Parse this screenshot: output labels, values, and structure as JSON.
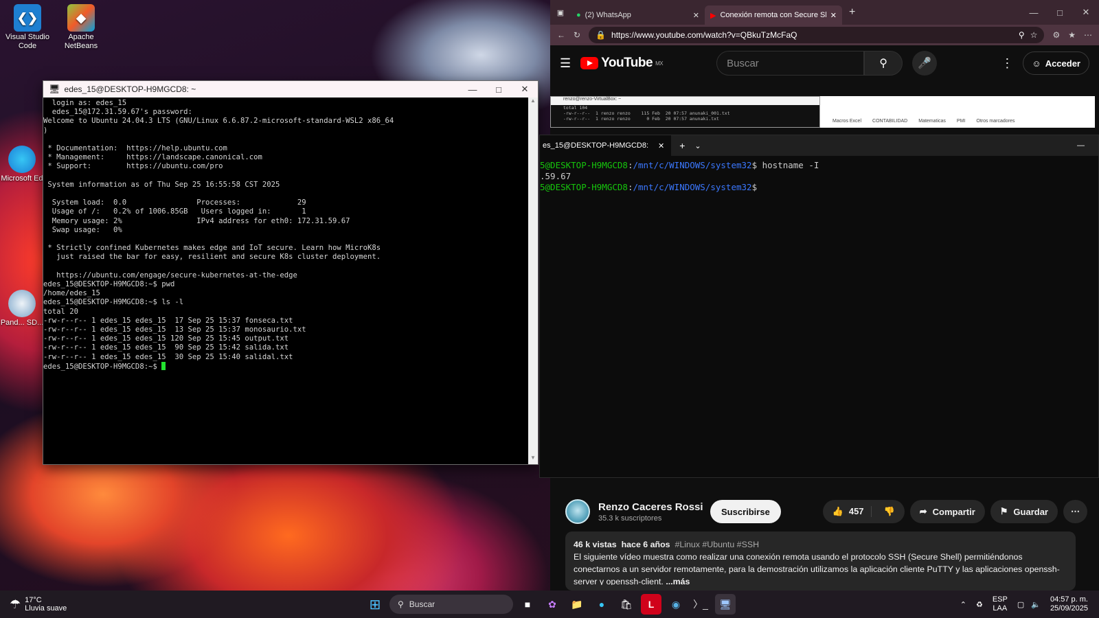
{
  "desktop": {
    "icons": [
      {
        "label": "Visual Studio Code"
      },
      {
        "label": "Apache NetBeans"
      },
      {
        "label": "Microsoft Ed"
      },
      {
        "label": "Pand... SD..."
      }
    ]
  },
  "putty": {
    "title": "edes_15@DESKTOP-H9MGCD8: ~",
    "lines": [
      "  login as: edes_15",
      "  edes_15@172.31.59.67's password:",
      "Welcome to Ubuntu 24.04.3 LTS (GNU/Linux 6.6.87.2-microsoft-standard-WSL2 x86_64",
      ")",
      "",
      " * Documentation:  https://help.ubuntu.com",
      " * Management:     https://landscape.canonical.com",
      " * Support:        https://ubuntu.com/pro",
      "",
      " System information as of Thu Sep 25 16:55:58 CST 2025",
      "",
      "  System load:  0.0                Processes:             29",
      "  Usage of /:   0.2% of 1006.85GB   Users logged in:       1",
      "  Memory usage: 2%                 IPv4 address for eth0: 172.31.59.67",
      "  Swap usage:   0%",
      "",
      " * Strictly confined Kubernetes makes edge and IoT secure. Learn how MicroK8s",
      "   just raised the bar for easy, resilient and secure K8s cluster deployment.",
      "",
      "   https://ubuntu.com/engage/secure-kubernetes-at-the-edge",
      "edes_15@DESKTOP-H9MGCD8:~$ pwd",
      "/home/edes_15",
      "edes_15@DESKTOP-H9MGCD8:~$ ls -l",
      "total 20",
      "-rw-r--r-- 1 edes_15 edes_15  17 Sep 25 15:37 fonseca.txt",
      "-rw-r--r-- 1 edes_15 edes_15  13 Sep 25 15:37 monosaurio.txt",
      "-rw-r--r-- 1 edes_15 edes_15 120 Sep 25 15:45 output.txt",
      "-rw-r--r-- 1 edes_15 edes_15  90 Sep 25 15:42 salida.txt",
      "-rw-r--r-- 1 edes_15 edes_15  30 Sep 25 15:40 salidal.txt"
    ],
    "prompt": "edes_15@DESKTOP-H9MGCD8:~$ "
  },
  "browser": {
    "tabs": [
      {
        "label": "(2) WhatsApp"
      },
      {
        "label": "Conexión remota con Secure She"
      }
    ],
    "url": "https://www.youtube.com/watch?v=QBkuTzMcFaQ"
  },
  "youtube": {
    "logo": "YouTube",
    "region": "MX",
    "search_placeholder": "Buscar",
    "signin": "Acceder",
    "channel_name": "Renzo Caceres Rossi",
    "subscribers": "35.3 k suscriptores",
    "subscribe": "Suscribirse",
    "likes": "457",
    "share": "Compartir",
    "save": "Guardar",
    "views": "46 k vistas",
    "age": "hace 6 años",
    "tags": "#Linux #Ubuntu #SSH",
    "description": "El siguiente vídeo muestra como realizar una conexión remota usando el protocolo SSH (Secure Shell) permitiéndonos conectarnos a un servidor remotamente, para la demostración utilizamos la aplicación cliente PuTTY y las aplicaciones openssh-server y openssh-client.",
    "more": "...más"
  },
  "video": {
    "vm_title": "renzo@renzo-VirtualBox: ~",
    "vm_lines": [
      "total 104",
      "-rw-r--r--  1 renzo renzo    115 Feb  20 07:57 anunaki_001.txt",
      "-rw-r--r--  1 renzo renzo      0 Feb  20 07:57 anunaki.txt"
    ],
    "bookmarks": [
      "Macros Excel",
      "CONTABILIDAD",
      "Matematicas",
      "PMI",
      "Otros marcadores"
    ],
    "wt_tab": "es_15@DESKTOP-H9MGCD8:",
    "wt_prompt_user": "5@DESKTOP-H9MGCD8",
    "wt_path": "/mnt/c/WINDOWS/system32",
    "wt_cmd": "$ hostname -I",
    "wt_output": ".59.67",
    "wt_prompt_end": "$"
  },
  "taskbar": {
    "temp": "17°C",
    "weather": "Lluvia suave",
    "search": "Buscar",
    "lang1": "ESP",
    "lang2": "LAA",
    "time": "04:57 p. m.",
    "date": "25/09/2025"
  },
  "colors": {
    "terminal_green": "#16c60c",
    "terminal_blue": "#3b78ff",
    "youtube_red": "#ff0000",
    "cursor_green": "#22e32f"
  }
}
